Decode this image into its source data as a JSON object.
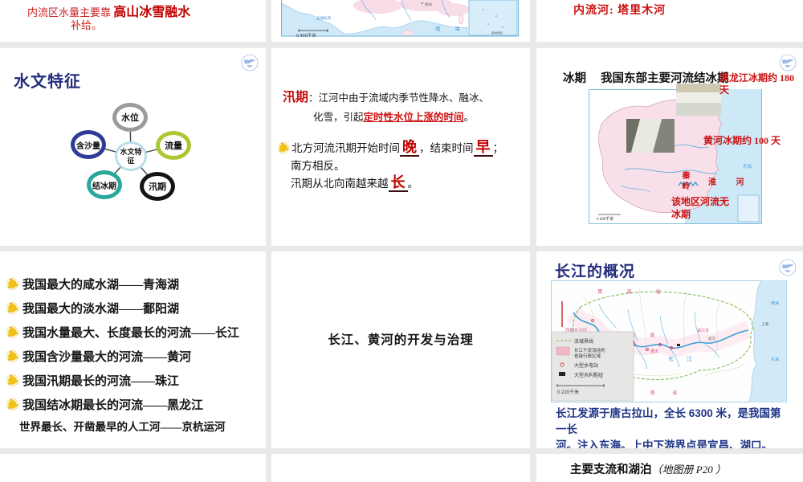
{
  "colors": {
    "gutter": "#e9e9e9",
    "red": "#cc1111",
    "dark_red": "#c00000",
    "navy_title": "#232c7c",
    "body_blue": "#1f3586",
    "ring_gray": "#9b9b9b",
    "ring_green": "#abc832",
    "ring_navy": "#2f3a96",
    "ring_teal": "#28a79b",
    "ring_black": "#141414",
    "ring_center": "#b9dde9",
    "sea_blue": "#cfe9f8",
    "land_pink": "#f9dfe9",
    "basin_green": "#7cb84a"
  },
  "s11": {
    "lead": "内流区水量主要靠",
    "highlight": "高山冰雪融水",
    "tail": "补给。"
  },
  "s12": {
    "scale_label": "0      400千米",
    "bay_label": "孟加拉湾",
    "sea_label": "南  海",
    "city_label": "杭州",
    "inset_label": "南海诸岛"
  },
  "s13": {
    "text": "内流河: 塔里木河"
  },
  "s21": {
    "title": "水文特征",
    "center_label": "水文特征",
    "node_top": "水位",
    "node_right": "流量",
    "node_left": "含沙量",
    "node_bottom_left": "结冰期",
    "node_bottom_right": "汛期"
  },
  "s22": {
    "term": "汛期",
    "colon": "：",
    "def_line1": "江河中由于流域内季节性降水、融冰、",
    "def_line2_pre": "化雪，引起",
    "def_line2_red": "定时性水位上涨的时间",
    "def_line2_end": "。",
    "p1_pre": "北方河流汛期开始时间",
    "p1_blank1": "晚",
    "p1_mid": "，结束时间",
    "p1_blank2": "早",
    "p1_end": "；",
    "p2": "南方相反。",
    "p3_pre": "汛期从北向南越来越",
    "p3_blank": "长",
    "p3_end": "。"
  },
  "s23": {
    "label": "冰期",
    "title": "我国东部主要河流结冰期",
    "ann_heilongjiang": "黑龙江冰期约 180 天",
    "ann_huanghe": "黄河冰期约 100 天",
    "ann_no_ice": "该地区河流无冰期",
    "qinling": "秦岭",
    "huaihe": "淮 河",
    "sea_label": "东海",
    "scale_label": "0    400千米"
  },
  "s31": {
    "items": [
      "我国最大的咸水湖——青海湖",
      "我国最大的淡水湖——鄱阳湖",
      "我国水量最大、长度最长的河流——长江",
      "我国含沙量最大的河流——黄河",
      "我国汛期最长的河流——珠江",
      "我国结冰期最长的河流——黑龙江",
      "世界最长、开凿最早的人工河——京杭运河"
    ]
  },
  "s32": {
    "title": "长江、黄河的开发与治理"
  },
  "s33": {
    "title": "长江的概况",
    "body_line1": "长江发源于唐古拉山，全长 6300 米，是我国第一长",
    "body_line2": "河。注入东海。上中下游界点是宜昌、湖口。",
    "legend_1": "流域界线",
    "legend_2a": "长江干流流经的",
    "legend_2b": "省级行政区域",
    "legend_3": "大型水电站",
    "legend_4": "大型水利枢纽",
    "legend_scale": "0        220千米",
    "river_label": "长 江",
    "label_qinghai": "青 海 省",
    "label_tibet": "西藏自治区",
    "label_sichuan": "四 川 省",
    "label_yunnan": "云 南 省",
    "label_chongqing": "重庆",
    "label_hubei": "湖北省",
    "label_wuhan": "武汉",
    "label_shanghai": "上海",
    "sea1": "黄海",
    "sea2": "东海"
  },
  "s43": {
    "main": "主要支流和湖泊",
    "note": "（地图册 P20 ）"
  }
}
